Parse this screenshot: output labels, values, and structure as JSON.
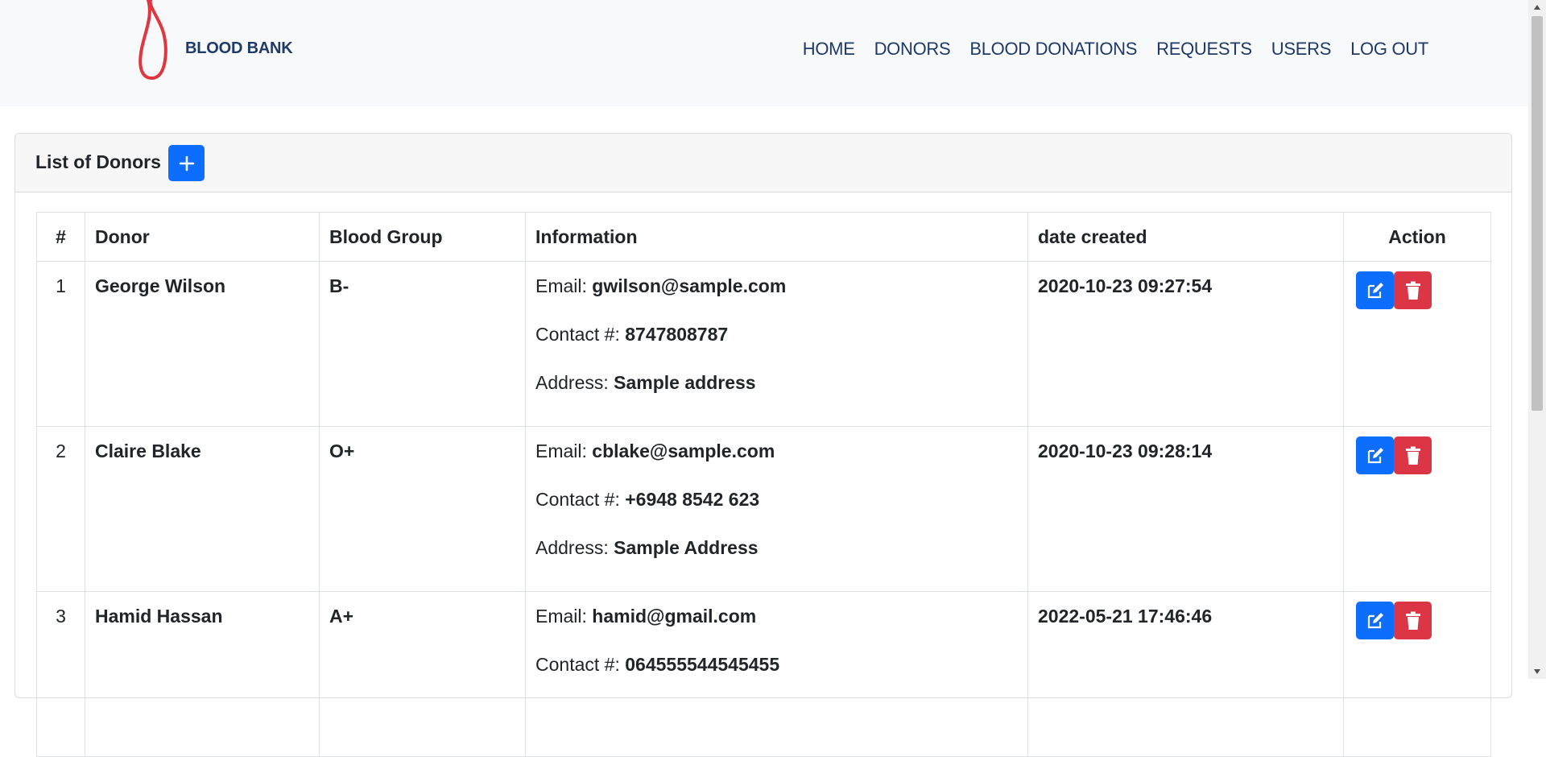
{
  "navbar": {
    "brand_text": "BLOOD BANK",
    "items": [
      {
        "label": "HOME"
      },
      {
        "label": "DONORS"
      },
      {
        "label": "BLOOD DONATIONS"
      },
      {
        "label": "REQUESTS"
      },
      {
        "label": "USERS"
      },
      {
        "label": "LOG OUT"
      }
    ]
  },
  "card": {
    "title": "List of Donors",
    "add_icon": "plus-icon"
  },
  "table": {
    "headers": {
      "num": "#",
      "donor": "Donor",
      "blood_group": "Blood Group",
      "information": "Information",
      "date_created": "date created",
      "action": "Action"
    },
    "labels": {
      "email": "Email:",
      "contact": "Contact #:",
      "address": "Address:"
    },
    "rows": [
      {
        "num": "1",
        "donor": "George Wilson",
        "blood_group": "B-",
        "email": "gwilson@sample.com",
        "contact": "8747808787",
        "address": "Sample address",
        "date_created": "2020-10-23 09:27:54"
      },
      {
        "num": "2",
        "donor": "Claire Blake",
        "blood_group": "O+",
        "email": "cblake@sample.com",
        "contact": "+6948 8542 623",
        "address": "Sample Address",
        "date_created": "2020-10-23 09:28:14"
      },
      {
        "num": "3",
        "donor": "Hamid Hassan",
        "blood_group": "A+",
        "email": "hamid@gmail.com",
        "contact": "064555544545455",
        "address": "",
        "date_created": "2022-05-21 17:46:46"
      }
    ]
  },
  "colors": {
    "nav_text": "#1f3a68",
    "brand_drop": "#e03640",
    "primary": "#0d6efd",
    "danger": "#dc3545"
  },
  "icons": {
    "edit": "edit-icon",
    "delete": "trash-icon"
  }
}
